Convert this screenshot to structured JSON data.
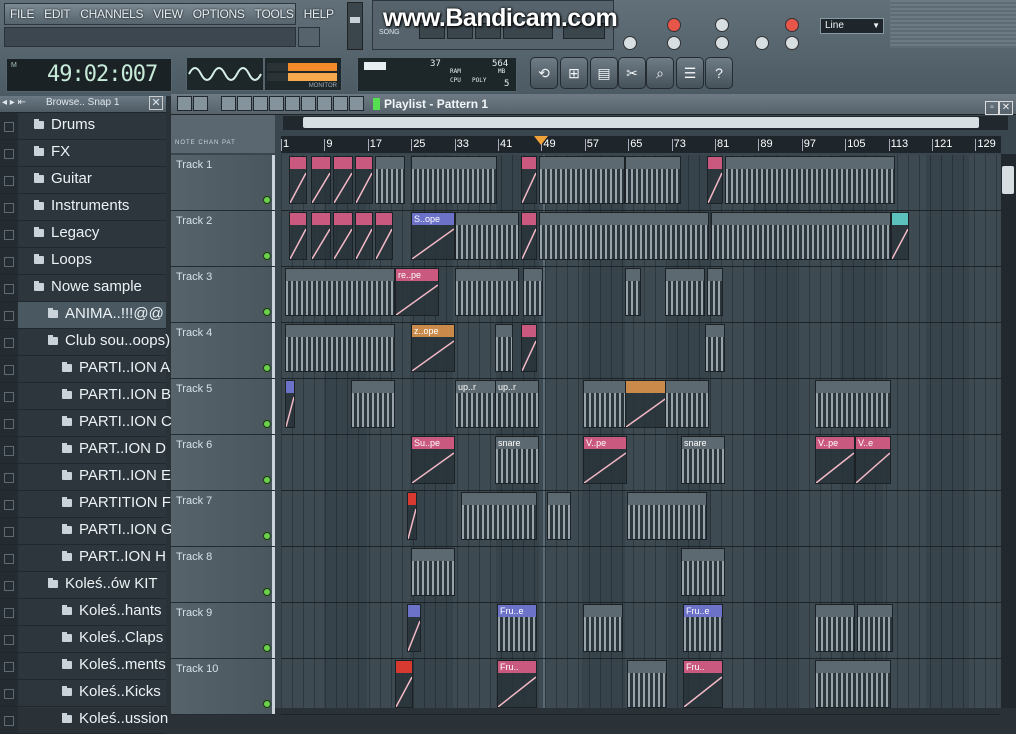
{
  "app": {
    "watermark": "www.Bandicam.com"
  },
  "menu": [
    "FILE",
    "EDIT",
    "CHANNELS",
    "VIEW",
    "OPTIONS",
    "TOOLS",
    "HELP"
  ],
  "transport": {
    "mode": "SONG",
    "time": "49:02:007"
  },
  "snap": {
    "value": "Line"
  },
  "cpu": {
    "ram": "37",
    "poly_max": "564",
    "poly": "5",
    "labels": [
      "RAM",
      "CPU",
      "POLY",
      "MB"
    ]
  },
  "monitor_label": "MONITOR",
  "browser": {
    "title": "Browse.. Snap 1",
    "items": [
      {
        "label": "Drums",
        "level": 0
      },
      {
        "label": "FX",
        "level": 0
      },
      {
        "label": "Guitar",
        "level": 0
      },
      {
        "label": "Instruments",
        "level": 0
      },
      {
        "label": "Legacy",
        "level": 0
      },
      {
        "label": "Loops",
        "level": 0
      },
      {
        "label": "Nowe sample",
        "level": 0
      },
      {
        "label": "ANIMA..!!!@@",
        "level": 1,
        "selected": true
      },
      {
        "label": "Club sou..oops)",
        "level": 1
      },
      {
        "label": "PARTI..ION A",
        "level": 2
      },
      {
        "label": "PARTI..ION B",
        "level": 2
      },
      {
        "label": "PARTI..ION C",
        "level": 2
      },
      {
        "label": "PART..ION D",
        "level": 2
      },
      {
        "label": "PARTI..ION E",
        "level": 2
      },
      {
        "label": "PARTITION F",
        "level": 2
      },
      {
        "label": "PARTI..ION G",
        "level": 2
      },
      {
        "label": "PART..ION H",
        "level": 2
      },
      {
        "label": "Koleś..ów KIT",
        "level": 1
      },
      {
        "label": "Koleś..hants",
        "level": 2
      },
      {
        "label": "Koleś..Claps",
        "level": 2
      },
      {
        "label": "Koleś..ments",
        "level": 2
      },
      {
        "label": "Koleś..Kicks",
        "level": 2
      },
      {
        "label": "Koleś..ussion",
        "level": 2
      }
    ]
  },
  "playlist": {
    "title": "Playlist - Pattern 1",
    "ruler": [
      "1",
      "9",
      "17",
      "25",
      "33",
      "41",
      "49",
      "57",
      "65",
      "73",
      "81",
      "89",
      "97",
      "105",
      "113",
      "121",
      "129"
    ],
    "tracks": [
      "Track 1",
      "Track 2",
      "Track 3",
      "Track 4",
      "Track 5",
      "Track 6",
      "Track 7",
      "Track 8",
      "Track 9",
      "Track 10"
    ],
    "clip_labels": [
      "S..ope",
      "re..pe",
      "z..ope",
      "up..r",
      "up..r",
      "Su..pe",
      "snare",
      "V..pe",
      "snare",
      "V..pe",
      "V..e",
      "Fru..e",
      "Fru..e",
      "Fru..",
      "Fru.."
    ]
  },
  "colors": {
    "pink": "#c9597e",
    "orange": "#c98a4a",
    "cyan": "#5cc0bc",
    "violet": "#6c72c8",
    "red": "#d83a32",
    "grey": "#5d6970"
  }
}
